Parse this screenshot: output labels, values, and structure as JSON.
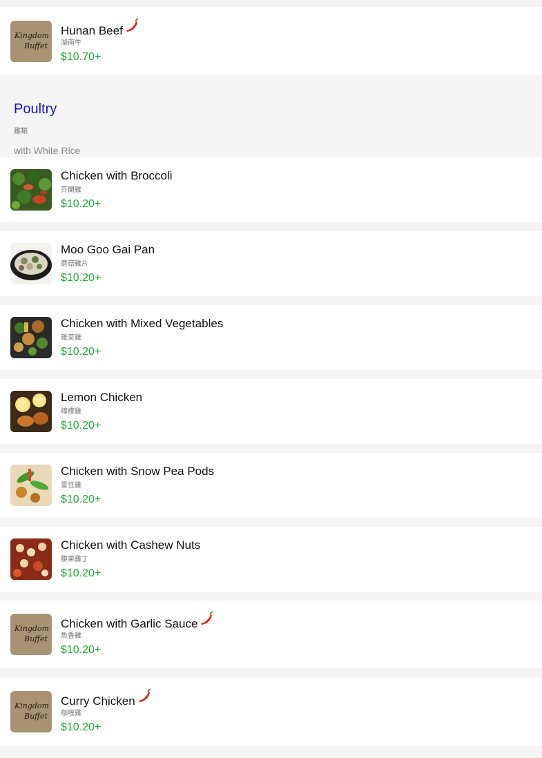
{
  "beef_items": [
    {
      "name": "Hunan Beef",
      "chinese": "湖南牛",
      "price": "$10.70+",
      "spicy": true,
      "image": "kingdom-buffet-logo",
      "logo_text": [
        "Kingdom",
        "Buffet"
      ]
    }
  ],
  "section": {
    "title": "Poultry",
    "chinese": "雞類",
    "note": "with White Rice"
  },
  "poultry_items": [
    {
      "name": "Chicken with Broccoli",
      "chinese": "芥蘭雞",
      "price": "$10.20+",
      "spicy": false,
      "image": "broccoli-chicken-photo"
    },
    {
      "name": "Moo Goo Gai Pan",
      "chinese": "蘑菇雞片",
      "price": "$10.20+",
      "spicy": false,
      "image": "moo-goo-gai-pan-photo"
    },
    {
      "name": "Chicken with Mixed Vegetables",
      "chinese": "雜菜雞",
      "price": "$10.20+",
      "spicy": false,
      "image": "mixed-veg-chicken-photo"
    },
    {
      "name": "Lemon Chicken",
      "chinese": "檸檬雞",
      "price": "$10.20+",
      "spicy": false,
      "image": "lemon-chicken-photo"
    },
    {
      "name": "Chicken with Snow Pea Pods",
      "chinese": "雪豆雞",
      "price": "$10.20+",
      "spicy": false,
      "image": "snow-pea-chicken-photo"
    },
    {
      "name": "Chicken with Cashew Nuts",
      "chinese": "腰果雞丁",
      "price": "$10.20+",
      "spicy": false,
      "image": "cashew-chicken-photo"
    },
    {
      "name": "Chicken with Garlic Sauce",
      "chinese": "魚香雞",
      "price": "$10.20+",
      "spicy": true,
      "image": "kingdom-buffet-logo",
      "logo_text": [
        "Kingdom",
        "Buffet"
      ]
    },
    {
      "name": "Curry Chicken",
      "chinese": "咖喱雞",
      "price": "$10.20+",
      "spicy": true,
      "image": "kingdom-buffet-logo",
      "logo_text": [
        "Kingdom",
        "Buffet"
      ]
    }
  ],
  "colors": {
    "price": "#1aab2c",
    "section_title": "#0f12c9",
    "chili": "#e0231b",
    "background": "#f5f5f5"
  },
  "icons": {
    "spicy": "chili-pepper-icon"
  }
}
